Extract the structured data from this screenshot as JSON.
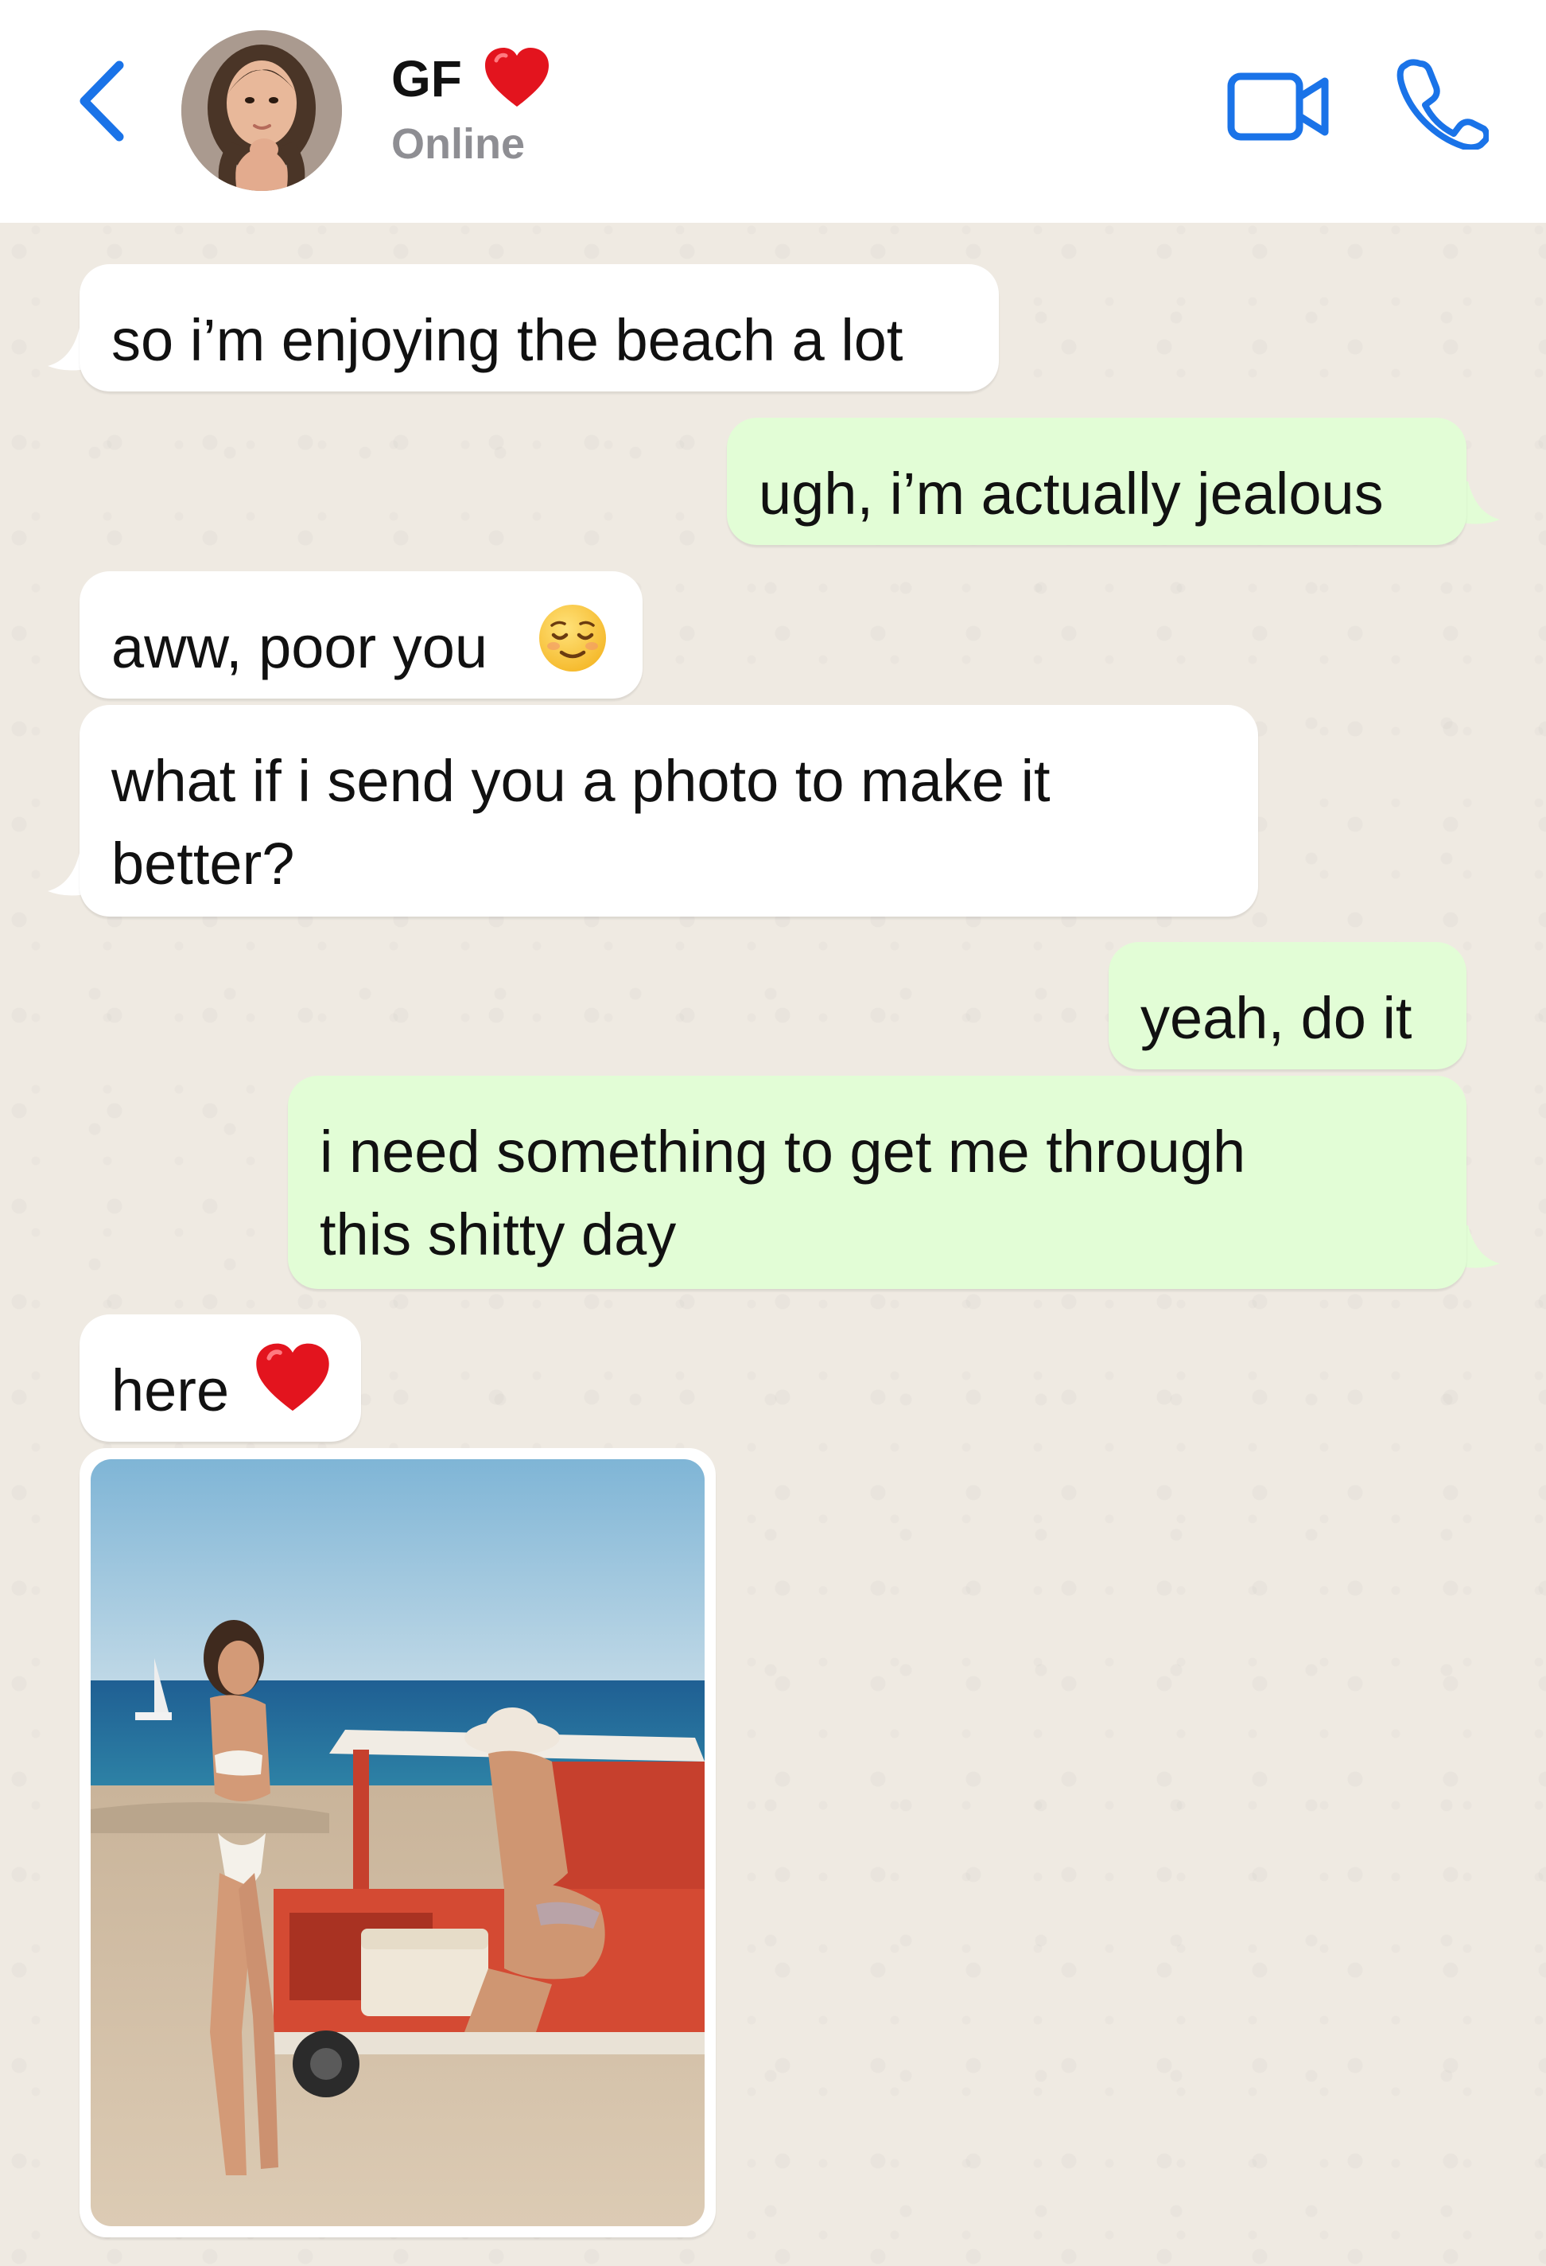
{
  "contact": {
    "name": "GF",
    "status": "Online"
  },
  "header": {
    "back_icon": "chevron-left-icon",
    "video_icon": "video-camera-icon",
    "call_icon": "phone-icon",
    "accent_color": "#1a73e8"
  },
  "messages": [
    {
      "from": "them",
      "text": "so i’m enjoying the beach a lot"
    },
    {
      "from": "me",
      "text": "ugh, i’m actually jealous"
    },
    {
      "from": "them",
      "text": "aww, poor you",
      "emoji": "relieved-face-icon"
    },
    {
      "from": "them",
      "text_lines": [
        "what if i send you a photo to make it",
        "better?"
      ]
    },
    {
      "from": "me",
      "text": "yeah, do it"
    },
    {
      "from": "me",
      "text_lines": [
        "i need something to get me through",
        "this shitty day"
      ]
    },
    {
      "from": "them",
      "text": "here",
      "emoji": "red-heart-icon"
    },
    {
      "from": "them",
      "type": "photo",
      "image": "beach-photo"
    }
  ],
  "colors": {
    "incoming_bubble": "#ffffff",
    "outgoing_bubble": "#e2fdd6",
    "wallpaper": "#efeae2",
    "status_text": "#8e8e93"
  }
}
